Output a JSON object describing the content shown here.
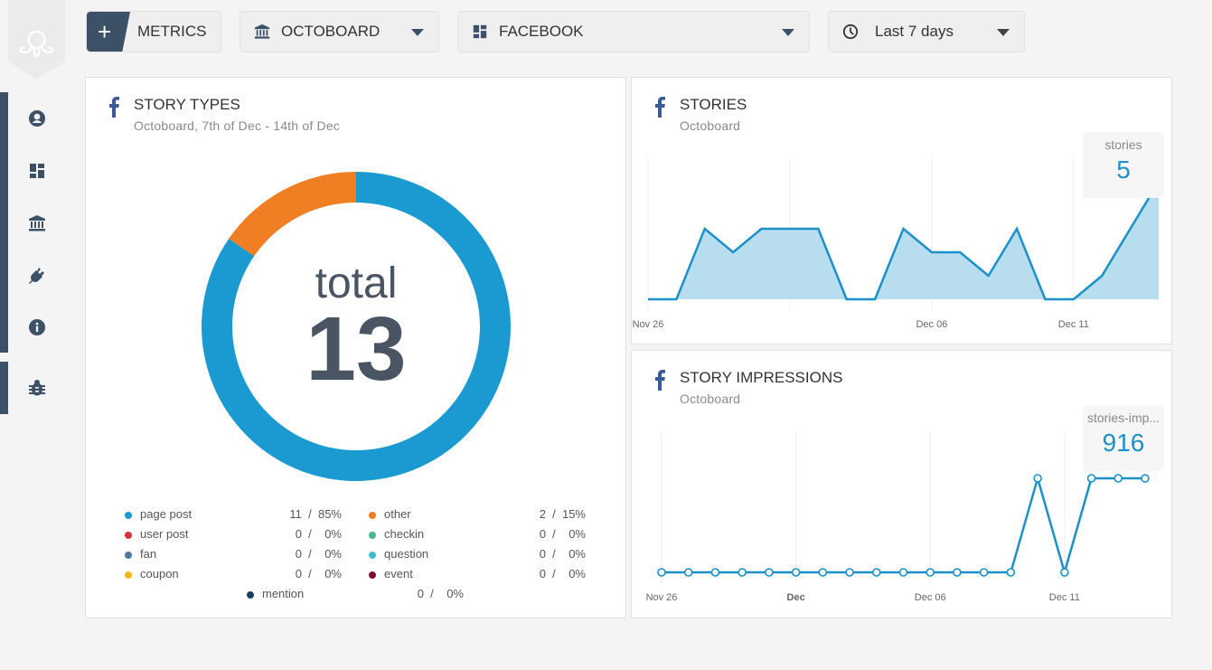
{
  "sidebar": {
    "logo": "octoboard-logo",
    "items": [
      {
        "icon": "user-circle-icon",
        "name": "sidebar-item-account"
      },
      {
        "icon": "dashboard-icon",
        "name": "sidebar-item-dashboards"
      },
      {
        "icon": "bank-icon",
        "name": "sidebar-item-organization"
      },
      {
        "icon": "plug-icon",
        "name": "sidebar-item-integrations"
      },
      {
        "icon": "info-icon",
        "name": "sidebar-item-info"
      },
      {
        "icon": "bug-icon",
        "name": "sidebar-item-report-bug"
      }
    ]
  },
  "toolbar": {
    "metrics_label": "METRICS",
    "metrics_plus": "+",
    "organization": "OCTOBOARD",
    "dashboard": "FACEBOOK",
    "date_range": "Last 7 days"
  },
  "colors": {
    "accent": "#3d5166",
    "series_blue": "#1b90c9",
    "area_fill": "#b7ddef",
    "facebook": "#3b5998"
  },
  "story_types": {
    "title": "STORY TYPES",
    "subtitle": "Octoboard, 7th of Dec - 14th of Dec",
    "total_label": "total",
    "total_value": "13",
    "legend": [
      {
        "name": "page post",
        "value": "11",
        "pct": "85%",
        "color": "#1b9ad1"
      },
      {
        "name": "other",
        "value": "2",
        "pct": "15%",
        "color": "#f07e23"
      },
      {
        "name": "user post",
        "value": "0",
        "pct": "0%",
        "color": "#d9313c"
      },
      {
        "name": "checkin",
        "value": "0",
        "pct": "0%",
        "color": "#4cb88c"
      },
      {
        "name": "fan",
        "value": "0",
        "pct": "0%",
        "color": "#4f78a0"
      },
      {
        "name": "question",
        "value": "0",
        "pct": "0%",
        "color": "#3dbfcc"
      },
      {
        "name": "coupon",
        "value": "0",
        "pct": "0%",
        "color": "#f2b619"
      },
      {
        "name": "event",
        "value": "0",
        "pct": "0%",
        "color": "#7a1328"
      },
      {
        "name": "mention",
        "value": "0",
        "pct": "0%",
        "color": "#173f5f"
      }
    ]
  },
  "stories": {
    "title": "STORIES",
    "subtitle": "Octoboard",
    "kpi_label": "stories",
    "kpi_value": "5"
  },
  "impressions": {
    "title": "STORY IMPRESSIONS",
    "subtitle": "Octoboard",
    "kpi_label": "stories-imp...",
    "kpi_value": "916"
  },
  "chart_data": [
    {
      "type": "pie",
      "title": "STORY TYPES",
      "categories": [
        "page post",
        "other",
        "user post",
        "checkin",
        "fan",
        "question",
        "coupon",
        "event",
        "mention"
      ],
      "values": [
        11,
        2,
        0,
        0,
        0,
        0,
        0,
        0,
        0
      ],
      "center_label": "total 13"
    },
    {
      "type": "area",
      "title": "STORIES",
      "x": [
        "Nov 26",
        "Nov 27",
        "Nov 28",
        "Nov 29",
        "Nov 30",
        "Dec 01",
        "Dec 02",
        "Dec 03",
        "Dec 04",
        "Dec 05",
        "Dec 06",
        "Dec 07",
        "Dec 08",
        "Dec 09",
        "Dec 10",
        "Dec 11",
        "Dec 12",
        "Dec 13",
        "Dec 14"
      ],
      "series": [
        {
          "name": "stories",
          "values": [
            0,
            0,
            3,
            2,
            3,
            3,
            3,
            0,
            0,
            3,
            2,
            2,
            1,
            3,
            0,
            0,
            1,
            3,
            5
          ]
        }
      ],
      "xtick_labels": [
        {
          "label": "Nov 26",
          "index": 0
        },
        {
          "label": "",
          "index": 5
        },
        {
          "label": "Dec 06",
          "index": 10
        },
        {
          "label": "Dec 11",
          "index": 15
        }
      ],
      "ylim": [
        0,
        5
      ],
      "grid": true
    },
    {
      "type": "line",
      "title": "STORY IMPRESSIONS",
      "x": [
        "Nov 26",
        "Nov 27",
        "Nov 28",
        "Nov 29",
        "Nov 30",
        "Dec 01",
        "Dec 02",
        "Dec 03",
        "Dec 04",
        "Dec 05",
        "Dec 06",
        "Dec 07",
        "Dec 08",
        "Dec 09",
        "Dec 10",
        "Dec 11",
        "Dec 12",
        "Dec 13",
        "Dec 14"
      ],
      "series": [
        {
          "name": "stories-impressions",
          "values": [
            0,
            0,
            0,
            0,
            0,
            0,
            0,
            0,
            0,
            0,
            0,
            0,
            0,
            0,
            229,
            0,
            229,
            229,
            229
          ]
        }
      ],
      "xtick_labels": [
        {
          "label": "Nov 26",
          "index": 0
        },
        {
          "label": "Dec",
          "index": 5,
          "bold": true
        },
        {
          "label": "Dec 06",
          "index": 10
        },
        {
          "label": "Dec 11",
          "index": 15
        }
      ],
      "ylim": [
        0,
        229
      ],
      "grid": true
    }
  ]
}
